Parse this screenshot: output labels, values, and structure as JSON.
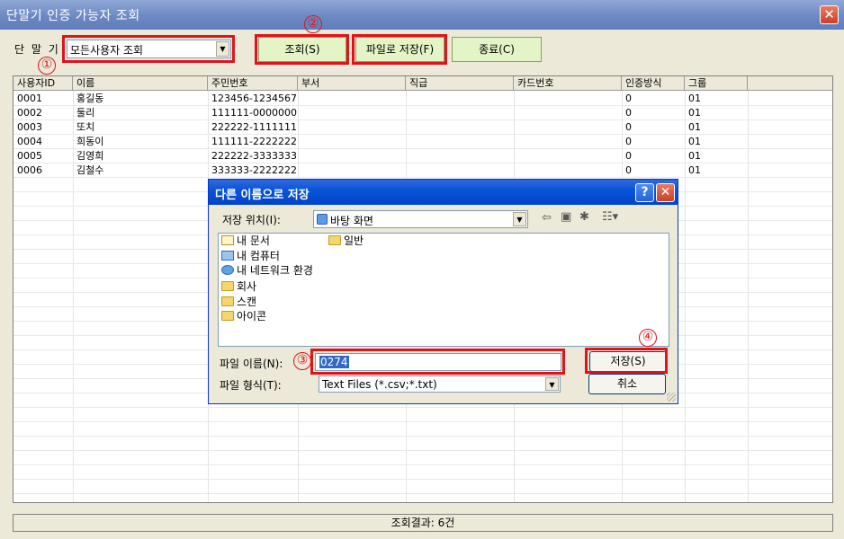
{
  "window": {
    "title": "단말기 인증 가능자 조회",
    "close_glyph": "✕"
  },
  "toolbar": {
    "device_label": "단 말 기",
    "device_combo_value": "모든사용자 조회",
    "search_button": "조회(S)",
    "save_file_button": "파일로 저장(F)",
    "exit_button": "종료(C)"
  },
  "annotations": {
    "n1": "①",
    "n2": "②",
    "n3": "③",
    "n4": "④"
  },
  "table": {
    "columns": [
      "사용자ID",
      "이름",
      "주민번호",
      "부서",
      "직급",
      "카드번호",
      "인증방식",
      "그룹"
    ],
    "rows": [
      [
        "0001",
        "홍길동",
        "123456-1234567",
        "",
        "",
        "",
        "0",
        "01"
      ],
      [
        "0002",
        "둘리",
        "111111-0000000",
        "",
        "",
        "",
        "0",
        "01"
      ],
      [
        "0003",
        "또치",
        "222222-1111111",
        "",
        "",
        "",
        "0",
        "01"
      ],
      [
        "0004",
        "희동이",
        "111111-2222222",
        "",
        "",
        "",
        "0",
        "01"
      ],
      [
        "0005",
        "김영희",
        "222222-3333333",
        "",
        "",
        "",
        "0",
        "01"
      ],
      [
        "0006",
        "김철수",
        "333333-2222222",
        "",
        "",
        "",
        "0",
        "01"
      ]
    ]
  },
  "status": {
    "result_text": "조회결과: 6건"
  },
  "save_dialog": {
    "title": "다른 이름으로 저장",
    "help_glyph": "?",
    "close_glyph": "✕",
    "location_label": "저장 위치(I):",
    "location_value": "바탕 화면",
    "toolbar_icons": [
      "back-icon",
      "up-folder-icon",
      "new-folder-icon",
      "view-menu-icon"
    ],
    "items": [
      {
        "name": "내 문서",
        "icon": "my-documents-icon"
      },
      {
        "name": "내 컴퓨터",
        "icon": "my-computer-icon"
      },
      {
        "name": "내 네트워크 환경",
        "icon": "network-icon"
      },
      {
        "name": "회사",
        "icon": "folder-icon"
      },
      {
        "name": "스캔",
        "icon": "folder-icon"
      },
      {
        "name": "아이콘",
        "icon": "folder-icon"
      },
      {
        "name": "일반",
        "icon": "folder-icon"
      }
    ],
    "filename_label": "파일 이름(N):",
    "filename_value": "0274",
    "filetype_label": "파일 형식(T):",
    "filetype_value": "Text Files (*.csv;*.txt)",
    "save_button": "저장(S)",
    "cancel_button": "취소"
  }
}
